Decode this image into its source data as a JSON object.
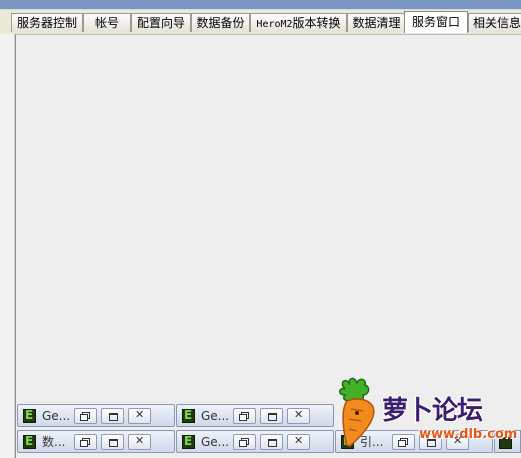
{
  "tabs": [
    {
      "label": "服务器控制"
    },
    {
      "label": "帐号"
    },
    {
      "label": "配置向导"
    },
    {
      "label": "数据备份"
    },
    {
      "label_prefix": "HeroM2",
      "label_suffix": "版本转换"
    },
    {
      "label": "数据清理"
    },
    {
      "label": "服务窗口",
      "active": true
    },
    {
      "label": "相关信息"
    }
  ],
  "minimized_windows": {
    "row1": [
      {
        "title": "Ge..."
      },
      {
        "title": "Ge..."
      }
    ],
    "row2": [
      {
        "title": "数..."
      },
      {
        "title": "Ge..."
      },
      {
        "title": "引..."
      }
    ]
  },
  "watermark": {
    "name": "萝卜论坛",
    "url": "www.dlb.com"
  }
}
